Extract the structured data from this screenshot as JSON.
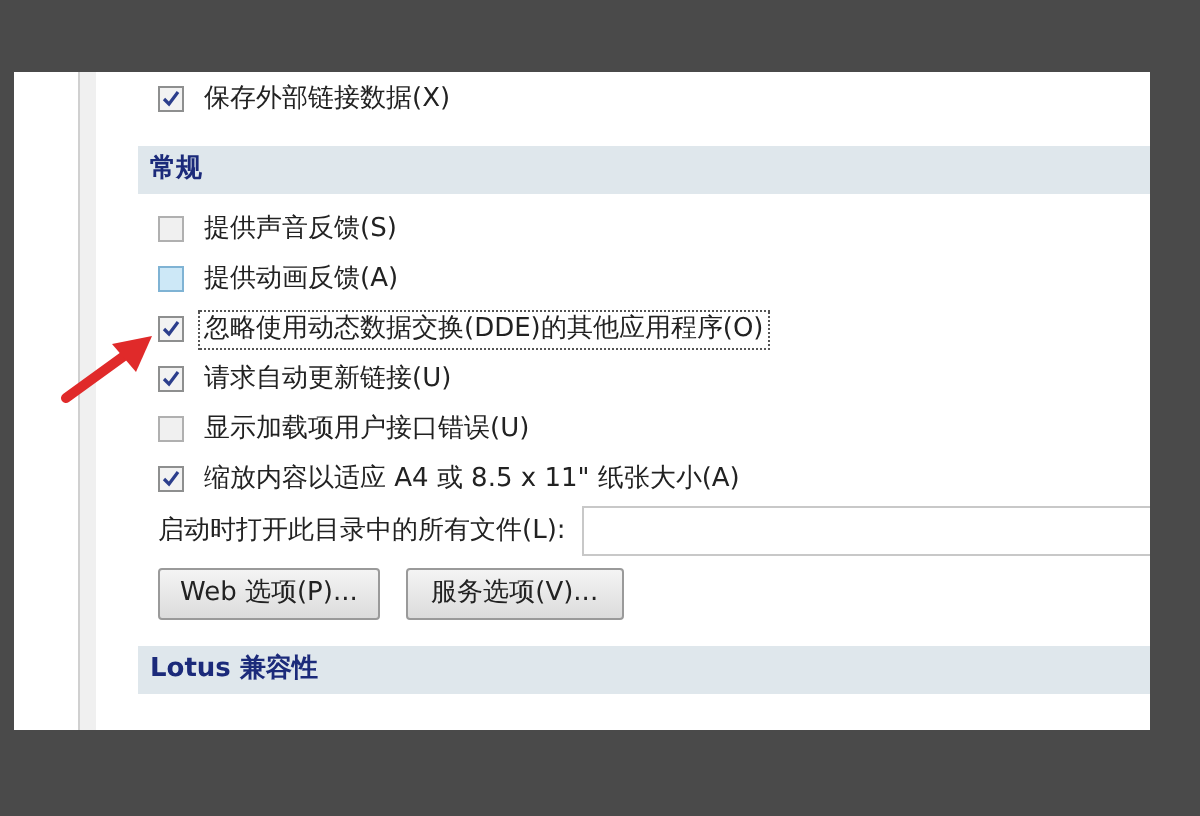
{
  "top_option": {
    "label": "保存外部链接数据(X)",
    "checked": true
  },
  "sections": [
    {
      "title": "常规",
      "options": [
        {
          "label": "提供声音反馈(S)",
          "checked": false,
          "hovered": false,
          "focused": false
        },
        {
          "label": "提供动画反馈(A)",
          "checked": false,
          "hovered": true,
          "focused": false
        },
        {
          "label": "忽略使用动态数据交换(DDE)的其他应用程序(O)",
          "checked": true,
          "hovered": false,
          "focused": true
        },
        {
          "label": "请求自动更新链接(U)",
          "checked": true,
          "hovered": false,
          "focused": false
        },
        {
          "label": "显示加载项用户接口错误(U)",
          "checked": false,
          "hovered": false,
          "focused": false
        },
        {
          "label": "缩放内容以适应 A4 或 8.5 x 11\" 纸张大小(A)",
          "checked": true,
          "hovered": false,
          "focused": false
        }
      ],
      "startup_field": {
        "label": "启动时打开此目录中的所有文件(L):"
      },
      "buttons": [
        "Web 选项(P)...",
        "服务选项(V)..."
      ]
    },
    {
      "title": "Lotus 兼容性"
    }
  ]
}
